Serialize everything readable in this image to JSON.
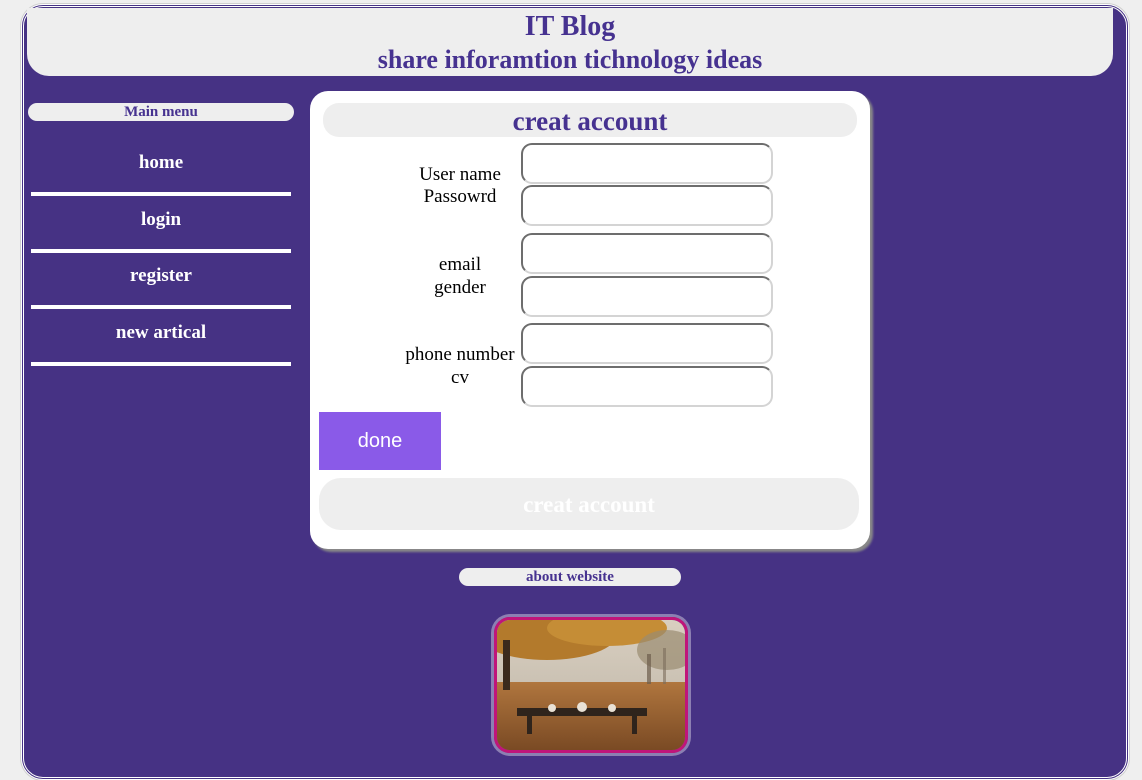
{
  "header": {
    "title": "IT Blog",
    "subtitle": "share inforamtion tichnology ideas"
  },
  "sidebar": {
    "title": "Main menu",
    "items": [
      {
        "label": "home"
      },
      {
        "label": "login"
      },
      {
        "label": "register"
      },
      {
        "label": "new artical"
      }
    ]
  },
  "form": {
    "title": "creat account",
    "labels": {
      "username": "User name",
      "password": "Passowrd",
      "email": "email",
      "gender": "gender",
      "phone": "phone number",
      "cv": "cv"
    },
    "done_label": "done",
    "submit_label": "creat account"
  },
  "about": {
    "title": "about website",
    "image_icon": "autumn-park-photo"
  },
  "colors": {
    "background": "#463284",
    "panel": "#eeeeee",
    "heading": "#463290",
    "button": "#8a5ae8",
    "photo_border": "#c0157a"
  }
}
